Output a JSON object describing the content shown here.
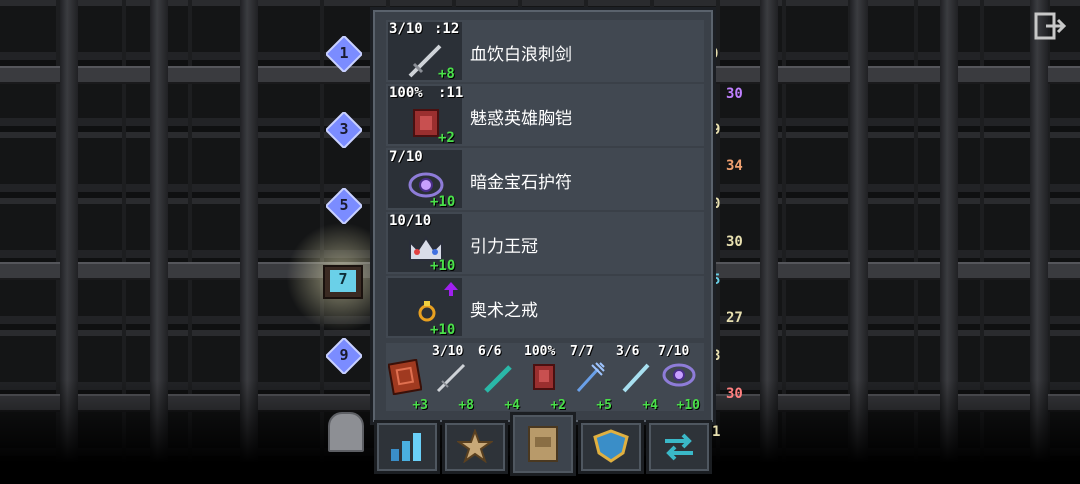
{
  "level_markers": [
    "1",
    "3",
    "5",
    "7",
    "9"
  ],
  "items": [
    {
      "prefix": "3/10",
      "level": ":12",
      "name": "血饮白浪刺剑",
      "bonus": "+8",
      "icon": "rapier-icon"
    },
    {
      "prefix": "100%",
      "level": ":11",
      "name": "魅惑英雄胸铠",
      "bonus": "+2",
      "icon": "armor-icon"
    },
    {
      "prefix": "7/10",
      "level": "",
      "name": "暗金宝石护符",
      "bonus": "+10",
      "icon": "amulet-icon"
    },
    {
      "prefix": "10/10",
      "level": "",
      "name": "引力王冠",
      "bonus": "+10",
      "icon": "crown-icon"
    },
    {
      "prefix": "",
      "level": "",
      "name": "奥术之戒",
      "bonus": "+10",
      "icon": "ring-icon"
    }
  ],
  "quickslots": [
    {
      "top": "",
      "bonus": "+3",
      "icon": "spellbook-icon"
    },
    {
      "top": "3/10",
      "bonus": "+8",
      "icon": "rapier-icon"
    },
    {
      "top": "6/6",
      "bonus": "+4",
      "icon": "wand-icon"
    },
    {
      "top": "100%",
      "bonus": "+2",
      "icon": "armor-icon"
    },
    {
      "top": "7/7",
      "bonus": "+5",
      "icon": "trident-icon"
    },
    {
      "top": "3/6",
      "bonus": "+4",
      "icon": "staff-icon"
    },
    {
      "top": "7/10",
      "bonus": "+10",
      "icon": "amulet-icon"
    }
  ],
  "right_side_labels": [
    "0",
    "30",
    "9",
    "34",
    "0",
    "30",
    "5",
    "27",
    "8",
    "30",
    "1"
  ],
  "tabs": [
    "stats-tab",
    "talents-tab",
    "inventory-tab",
    "quest-tab",
    "swap-tab"
  ],
  "colors": {
    "panel": "#3a4048",
    "bonus_green": "#4ae04a",
    "gem": "#7b8cff"
  }
}
